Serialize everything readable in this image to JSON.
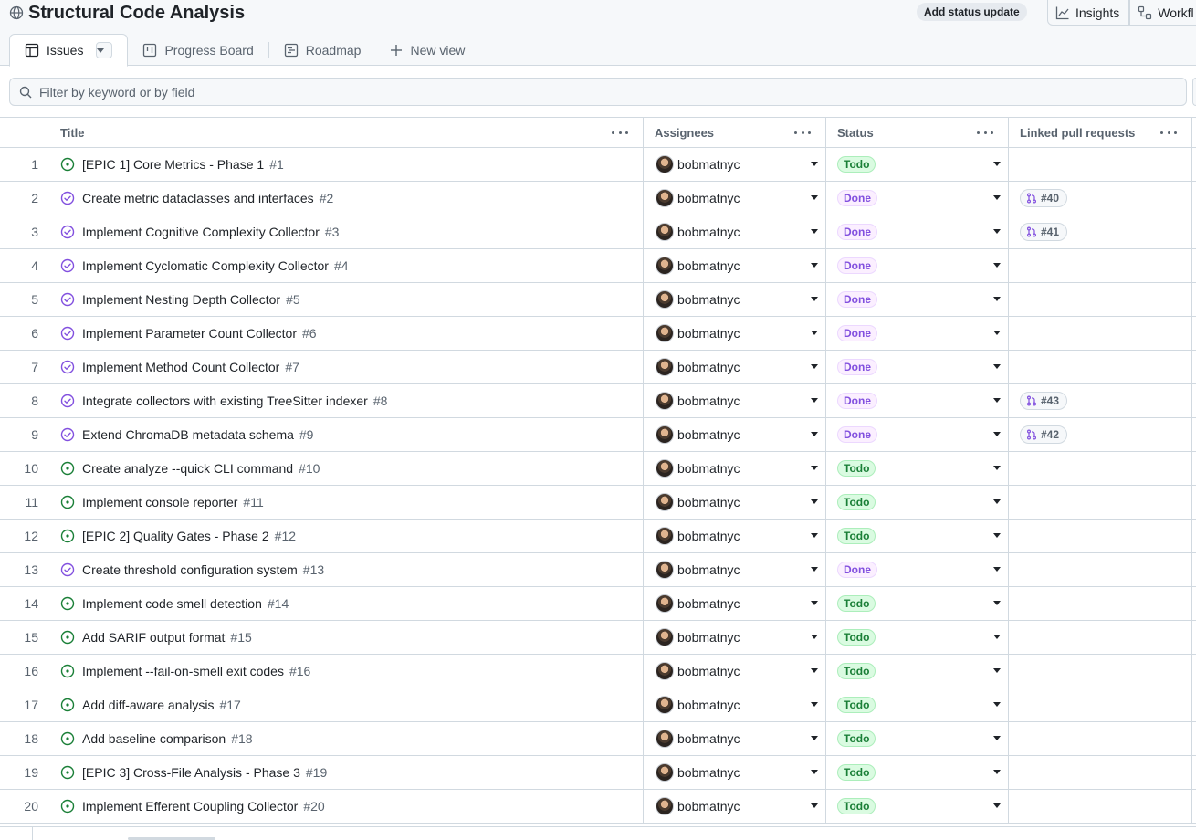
{
  "header": {
    "title": "Structural Code Analysis",
    "status_update_label": "Add status update",
    "insights_label": "Insights",
    "workflows_label": "Workfl"
  },
  "tabs": [
    {
      "label": "Issues",
      "icon": "table-icon",
      "active": true
    },
    {
      "label": "Progress Board",
      "icon": "board-icon",
      "active": false
    },
    {
      "label": "Roadmap",
      "icon": "roadmap-icon",
      "active": false
    },
    {
      "label": "New view",
      "icon": "plus-icon",
      "active": false
    }
  ],
  "filter": {
    "placeholder": "Filter by keyword or by field"
  },
  "columns": {
    "title": "Title",
    "assignees": "Assignees",
    "status": "Status",
    "linked_prs": "Linked pull requests"
  },
  "colors": {
    "todo": "#1a7f37",
    "done": "#8250df",
    "border": "#d1d9e0"
  },
  "rows": [
    {
      "n": "1",
      "title": "[EPIC 1] Core Metrics - Phase 1",
      "issue": "#1",
      "assignee": "bobmatnyc",
      "status": "Todo",
      "pr": ""
    },
    {
      "n": "2",
      "title": "Create metric dataclasses and interfaces",
      "issue": "#2",
      "assignee": "bobmatnyc",
      "status": "Done",
      "pr": "#40"
    },
    {
      "n": "3",
      "title": "Implement Cognitive Complexity Collector",
      "issue": "#3",
      "assignee": "bobmatnyc",
      "status": "Done",
      "pr": "#41"
    },
    {
      "n": "4",
      "title": "Implement Cyclomatic Complexity Collector",
      "issue": "#4",
      "assignee": "bobmatnyc",
      "status": "Done",
      "pr": ""
    },
    {
      "n": "5",
      "title": "Implement Nesting Depth Collector",
      "issue": "#5",
      "assignee": "bobmatnyc",
      "status": "Done",
      "pr": ""
    },
    {
      "n": "6",
      "title": "Implement Parameter Count Collector",
      "issue": "#6",
      "assignee": "bobmatnyc",
      "status": "Done",
      "pr": ""
    },
    {
      "n": "7",
      "title": "Implement Method Count Collector",
      "issue": "#7",
      "assignee": "bobmatnyc",
      "status": "Done",
      "pr": ""
    },
    {
      "n": "8",
      "title": "Integrate collectors with existing TreeSitter indexer",
      "issue": "#8",
      "assignee": "bobmatnyc",
      "status": "Done",
      "pr": "#43"
    },
    {
      "n": "9",
      "title": "Extend ChromaDB metadata schema",
      "issue": "#9",
      "assignee": "bobmatnyc",
      "status": "Done",
      "pr": "#42"
    },
    {
      "n": "10",
      "title": "Create analyze --quick CLI command",
      "issue": "#10",
      "assignee": "bobmatnyc",
      "status": "Todo",
      "pr": ""
    },
    {
      "n": "11",
      "title": "Implement console reporter",
      "issue": "#11",
      "assignee": "bobmatnyc",
      "status": "Todo",
      "pr": ""
    },
    {
      "n": "12",
      "title": "[EPIC 2] Quality Gates - Phase 2",
      "issue": "#12",
      "assignee": "bobmatnyc",
      "status": "Todo",
      "pr": ""
    },
    {
      "n": "13",
      "title": "Create threshold configuration system",
      "issue": "#13",
      "assignee": "bobmatnyc",
      "status": "Done",
      "pr": ""
    },
    {
      "n": "14",
      "title": "Implement code smell detection",
      "issue": "#14",
      "assignee": "bobmatnyc",
      "status": "Todo",
      "pr": ""
    },
    {
      "n": "15",
      "title": "Add SARIF output format",
      "issue": "#15",
      "assignee": "bobmatnyc",
      "status": "Todo",
      "pr": ""
    },
    {
      "n": "16",
      "title": "Implement --fail-on-smell exit codes",
      "issue": "#16",
      "assignee": "bobmatnyc",
      "status": "Todo",
      "pr": ""
    },
    {
      "n": "17",
      "title": "Add diff-aware analysis",
      "issue": "#17",
      "assignee": "bobmatnyc",
      "status": "Todo",
      "pr": ""
    },
    {
      "n": "18",
      "title": "Add baseline comparison",
      "issue": "#18",
      "assignee": "bobmatnyc",
      "status": "Todo",
      "pr": ""
    },
    {
      "n": "19",
      "title": "[EPIC 3] Cross-File Analysis - Phase 3",
      "issue": "#19",
      "assignee": "bobmatnyc",
      "status": "Todo",
      "pr": ""
    },
    {
      "n": "20",
      "title": "Implement Efferent Coupling Collector",
      "issue": "#20",
      "assignee": "bobmatnyc",
      "status": "Todo",
      "pr": ""
    }
  ]
}
